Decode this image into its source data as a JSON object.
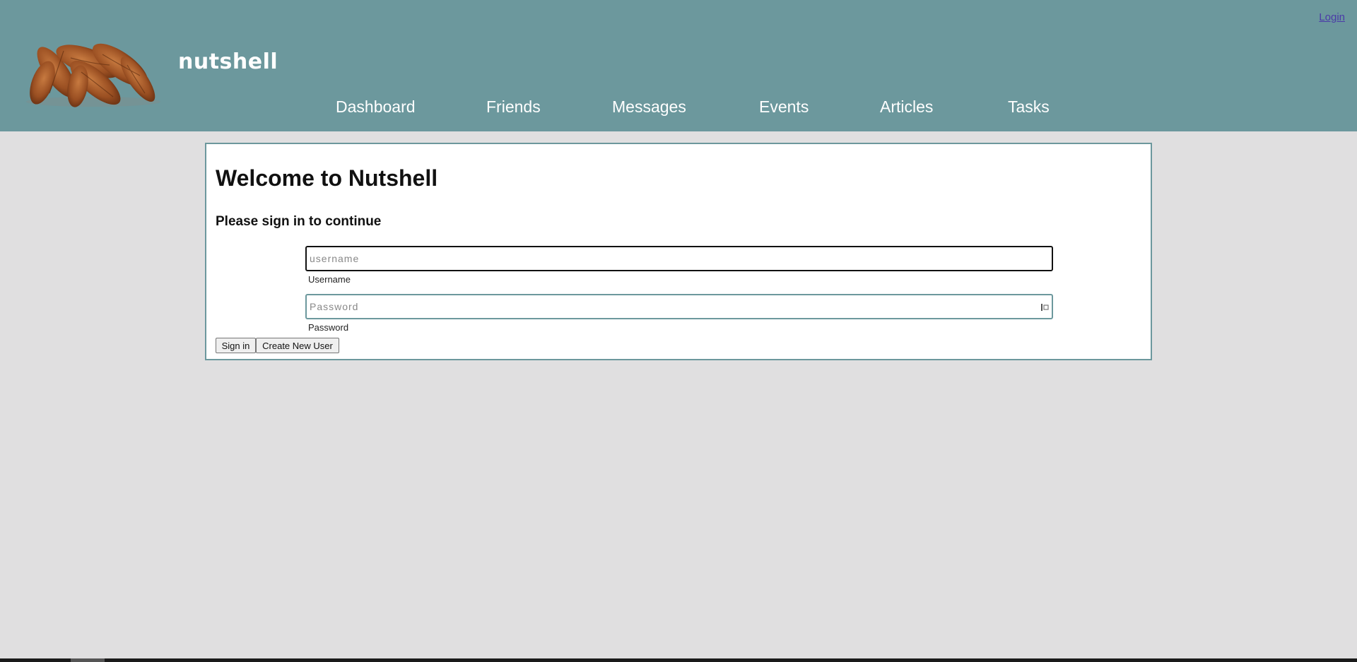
{
  "header": {
    "brand": "nutshell",
    "login_label": "Login",
    "logo_icon": "pecan-logo-icon",
    "bg_color": "#6c989d"
  },
  "nav": {
    "items": [
      {
        "label": "Dashboard"
      },
      {
        "label": "Friends"
      },
      {
        "label": "Messages"
      },
      {
        "label": "Events"
      },
      {
        "label": "Articles"
      },
      {
        "label": "Tasks"
      }
    ]
  },
  "login_form": {
    "title": "Welcome to Nutshell",
    "subtitle": "Please sign in to continue",
    "username": {
      "value": "",
      "placeholder": "username",
      "label": "Username"
    },
    "password": {
      "value": "",
      "placeholder": "Password",
      "label": "Password"
    },
    "signin_label": "Sign in",
    "create_label": "Create New User"
  }
}
